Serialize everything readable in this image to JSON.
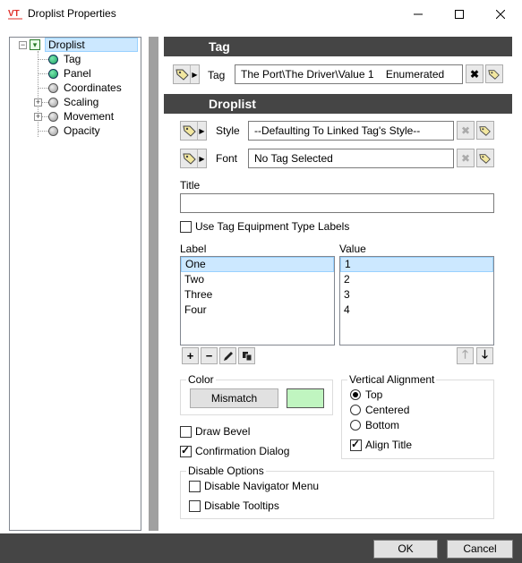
{
  "window": {
    "title": "Droplist Properties",
    "logo_text": "VT"
  },
  "tree": {
    "items": [
      {
        "label": "Droplist",
        "icon": "droplist-icon"
      },
      {
        "label": "Tag",
        "icon": "green-dot"
      },
      {
        "label": "Panel",
        "icon": "green-dot"
      },
      {
        "label": "Coordinates",
        "icon": "gray-dot"
      },
      {
        "label": "Scaling",
        "icon": "gray-dot"
      },
      {
        "label": "Movement",
        "icon": "gray-dot"
      },
      {
        "label": "Opacity",
        "icon": "gray-dot"
      }
    ]
  },
  "tag_section": {
    "header": "Tag",
    "tag_label": "Tag",
    "tag_value": "The Port\\The Driver\\Value 1    Enumerated"
  },
  "droplist_section": {
    "header": "Droplist",
    "style_label": "Style",
    "style_value": "--Defaulting To Linked Tag's Style--",
    "font_label": "Font",
    "font_value": "No Tag Selected",
    "title_label": "Title",
    "title_value": "",
    "use_labels_text": "Use Tag Equipment Type Labels",
    "use_labels_checked": false
  },
  "lists": {
    "label_header": "Label",
    "value_header": "Value",
    "labels": [
      "One",
      "Two",
      "Three",
      "Four"
    ],
    "values": [
      "1",
      "2",
      "3",
      "4"
    ],
    "selected_index": 0
  },
  "color": {
    "group_title": "Color",
    "button_label": "Mismatch",
    "swatch": "#c0f5c0"
  },
  "vertical_alignment": {
    "group_title": "Vertical Alignment",
    "options": [
      "Top",
      "Centered",
      "Bottom"
    ],
    "selected": "Top",
    "align_title_label": "Align Title",
    "align_title_checked": true
  },
  "checks": {
    "draw_bevel": "Draw Bevel",
    "draw_bevel_checked": false,
    "confirmation": "Confirmation Dialog",
    "confirmation_checked": true
  },
  "disable_options": {
    "group_title": "Disable Options",
    "navigator": "Disable Navigator Menu",
    "navigator_checked": false,
    "tooltips": "Disable Tooltips",
    "tooltips_checked": false
  },
  "footer": {
    "ok": "OK",
    "cancel": "Cancel"
  },
  "colors": {
    "header_bg": "#454545",
    "selection": "#cce8ff",
    "logo_red": "#e0302a"
  }
}
